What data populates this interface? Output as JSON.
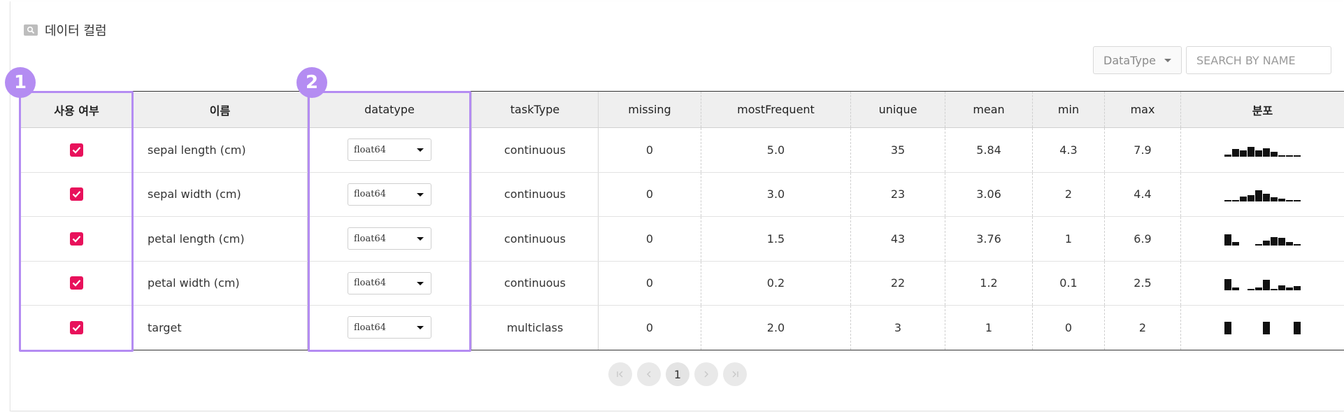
{
  "section": {
    "title": "데이터 컬럼",
    "icon": "search-icon"
  },
  "filters": {
    "datatype_select": "DataType",
    "search_placeholder": "SEARCH BY NAME"
  },
  "table": {
    "headers": {
      "use": "사용 여부",
      "name": "이름",
      "datatype": "datatype",
      "taskType": "taskType",
      "missing": "missing",
      "mostFrequent": "mostFrequent",
      "unique": "unique",
      "mean": "mean",
      "min": "min",
      "max": "max",
      "distribution": "분포"
    },
    "rows": [
      {
        "checked": true,
        "name": "sepal length (cm)",
        "datatype": "float64",
        "taskType": "continuous",
        "missing": "0",
        "mostFrequent": "5.0",
        "unique": "35",
        "mean": "5.84",
        "min": "4.3",
        "max": "7.9",
        "histogram": [
          0.2,
          0.6,
          0.5,
          0.8,
          0.5,
          0.7,
          0.4,
          0.1,
          0.1,
          0.1
        ]
      },
      {
        "checked": true,
        "name": "sepal width (cm)",
        "datatype": "float64",
        "taskType": "continuous",
        "missing": "0",
        "mostFrequent": "3.0",
        "unique": "23",
        "mean": "3.06",
        "min": "2",
        "max": "4.4",
        "histogram": [
          0.05,
          0.1,
          0.4,
          0.5,
          0.9,
          0.6,
          0.3,
          0.2,
          0.05,
          0.05
        ]
      },
      {
        "checked": true,
        "name": "petal length (cm)",
        "datatype": "float64",
        "taskType": "continuous",
        "missing": "0",
        "mostFrequent": "1.5",
        "unique": "43",
        "mean": "3.76",
        "min": "1",
        "max": "6.9",
        "histogram": [
          0.9,
          0.3,
          0,
          0,
          0.1,
          0.4,
          0.7,
          0.6,
          0.3,
          0.1
        ]
      },
      {
        "checked": true,
        "name": "petal width (cm)",
        "datatype": "float64",
        "taskType": "continuous",
        "missing": "0",
        "mostFrequent": "0.2",
        "unique": "22",
        "mean": "1.2",
        "min": "0.1",
        "max": "2.5",
        "histogram": [
          0.9,
          0.2,
          0,
          0.1,
          0.2,
          0.8,
          0.1,
          0.4,
          0.2,
          0.3
        ]
      },
      {
        "checked": true,
        "name": "target",
        "datatype": "float64",
        "taskType": "multiclass",
        "missing": "0",
        "mostFrequent": "2.0",
        "unique": "3",
        "mean": "1",
        "min": "0",
        "max": "2",
        "histogram": [
          1,
          0,
          0,
          0,
          0,
          1,
          0,
          0,
          0,
          1
        ]
      }
    ]
  },
  "annotations": {
    "badge_1": "1",
    "badge_2": "2",
    "color": "#b48cf2"
  },
  "pagination": {
    "current_page": "1",
    "first_icon": "first-page-icon",
    "prev_icon": "chevron-left-icon",
    "next_icon": "chevron-right-icon",
    "last_icon": "last-page-icon"
  },
  "colors": {
    "checkbox": "#e8115b",
    "header_bg": "#efefef"
  }
}
